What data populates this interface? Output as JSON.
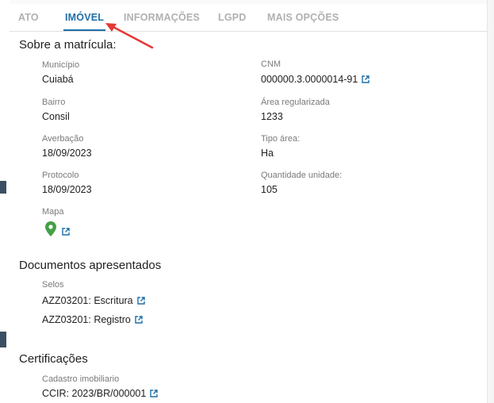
{
  "tabs": [
    {
      "label": "ATO",
      "active": false
    },
    {
      "label": "IMÓVEL",
      "active": true
    },
    {
      "label": "INFORMAÇÕES",
      "active": false
    },
    {
      "label": "LGPD",
      "active": false
    },
    {
      "label": "MAIS OPÇÕES",
      "active": false
    }
  ],
  "sobre": {
    "title": "Sobre a matrícula:",
    "municipio_label": "Município",
    "municipio_value": "Cuiabá",
    "cnm_label": "CNM",
    "cnm_value": "000000.3.0000014-91",
    "bairro_label": "Bairro",
    "bairro_value": "Consil",
    "area_label": "Área regularizada",
    "area_value": "1233",
    "averbacao_label": "Averbação",
    "averbacao_value": "18/09/2023",
    "tipo_label": "Tipo área:",
    "tipo_value": "Ha",
    "protocolo_label": "Protocolo",
    "protocolo_value": "18/09/2023",
    "quantidade_label": "Quantidade unidade:",
    "quantidade_value": "105",
    "mapa_label": "Mapa"
  },
  "documentos": {
    "title": "Documentos apresentados",
    "selos_label": "Selos",
    "selos": [
      "AZZ03201: Escritura",
      "AZZ03201: Registro"
    ]
  },
  "certificacoes": {
    "title": "Certificações",
    "cadastro_label": "Cadastro imobiliario",
    "cadastro_value": "CCIR: 2023/BR/000001"
  },
  "colors": {
    "accent": "#1f6fa8",
    "map_pin": "#43a047",
    "arrow": "#e53935",
    "tab_inactive": "#b0b0b0"
  },
  "icons": [
    "external-link-icon",
    "map-pin-icon",
    "annotation-arrow"
  ]
}
